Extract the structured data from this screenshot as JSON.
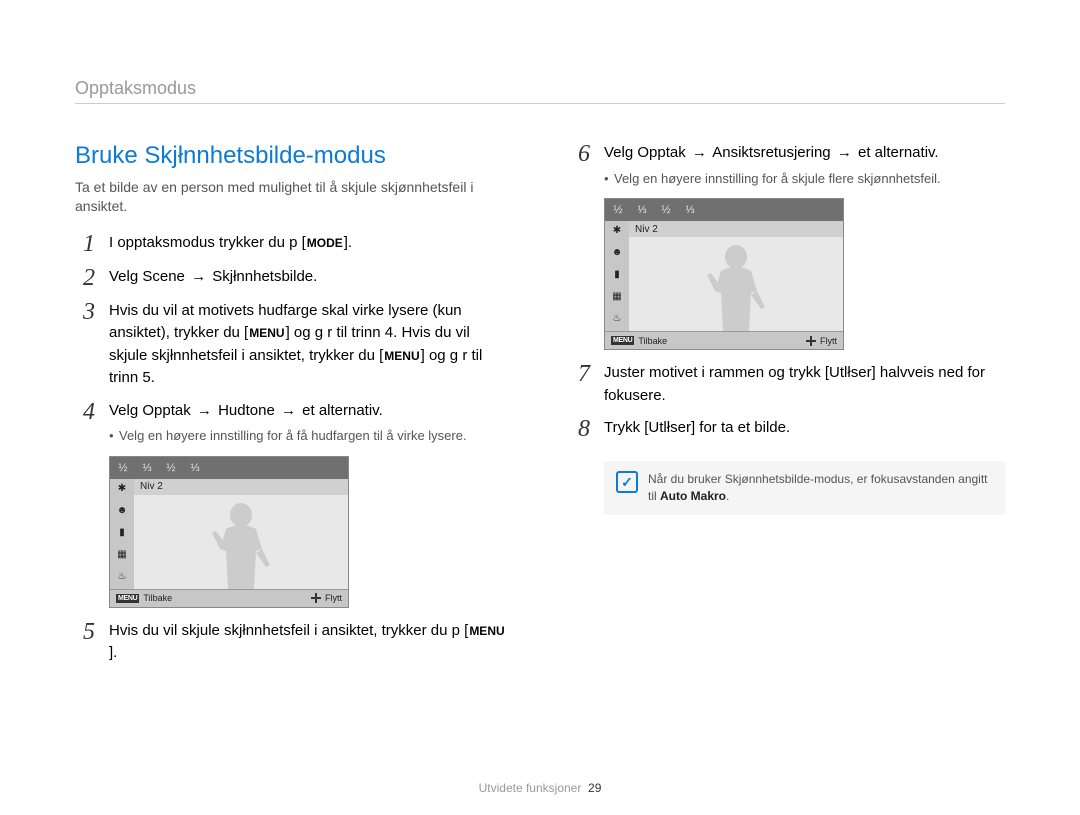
{
  "header": {
    "section_name": "Opptaksmodus"
  },
  "title": "Bruke Skjłnnhetsbilde-modus",
  "subtitle": "Ta et bilde av en person med mulighet til å skjule skjønnhetsfeil i ansiktet.",
  "buttons": {
    "mode": "MODE",
    "menu": "MENU"
  },
  "steps_left": {
    "s1": "I opptaksmodus trykker du p  [",
    "s1_end": "].",
    "s2_a": "Velg Scene",
    "s2_b": "Skjłnnhetsbilde.",
    "s3_a": "Hvis du vil at motivets hudfarge skal virke lysere (kun ansiktet), trykker du [",
    "s3_b": "] og g r til trinn 4. Hvis du vil skjule skjłnnhetsfeil i ansiktet, trykker du [",
    "s3_c": "] og g r til trinn 5.",
    "s4_a": "Velg Opptak",
    "s4_b": "Hudtone",
    "s4_c": "et alternativ.",
    "s4_bullet": "Velg en høyere innstilling for å få hudfargen til å virke lysere.",
    "s5_a": "Hvis du vil skjule skjłnnhetsfeil i ansiktet, trykker du p  [",
    "s5_b": "]."
  },
  "steps_right": {
    "s6_a": "Velg Opptak",
    "s6_b": "Ansiktsretusjering",
    "s6_c": "et alternativ.",
    "s6_bullet": "Velg en høyere innstilling for å skjule flere skjønnhetsfeil.",
    "s7": "Juster motivet i rammen og trykk [Utlłser] halvveis ned for   fokusere.",
    "s8": "Trykk [Utlłser] for   ta et bilde."
  },
  "lcd": {
    "level_label": "Niv  2",
    "back": "Tilbake",
    "move": "Flytt",
    "top_icons": [
      "½",
      "⅓",
      "½",
      "⅓"
    ]
  },
  "note": {
    "text_a": "Når du bruker Skjønnhetsbilde-modus, er fokusavstanden angitt til ",
    "text_b": "Auto Makro",
    "text_c": "."
  },
  "arrow": "→",
  "footer": {
    "label": "Utvidete funksjoner",
    "page": "29"
  }
}
